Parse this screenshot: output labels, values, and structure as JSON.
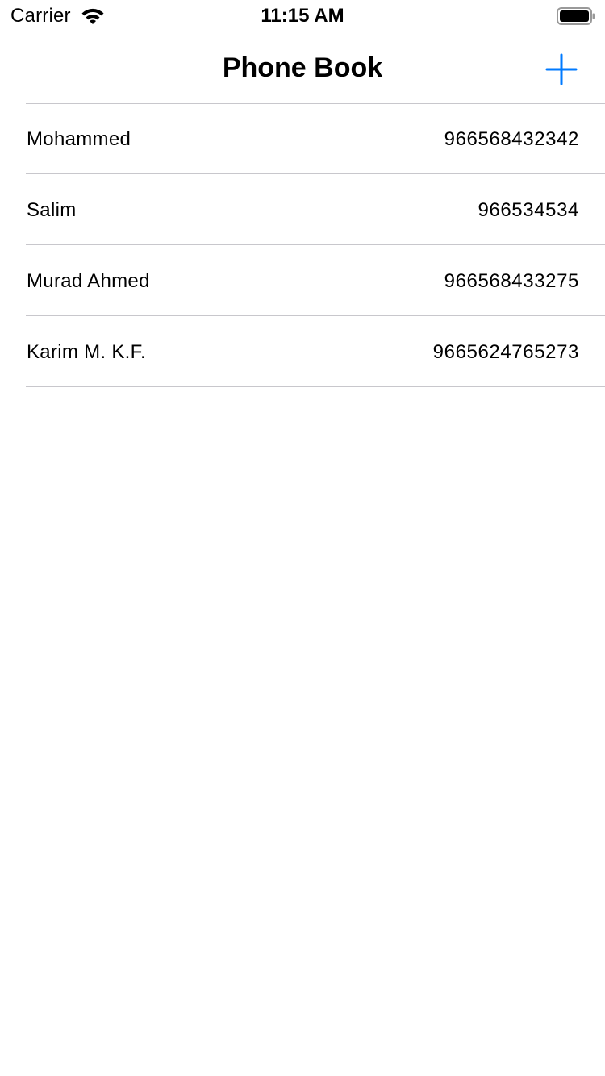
{
  "status_bar": {
    "carrier": "Carrier",
    "time": "11:15 AM",
    "wifi_icon": "wifi-icon",
    "battery_icon": "battery-icon"
  },
  "nav": {
    "title": "Phone Book",
    "add_icon": "plus-icon",
    "accent_color": "#007aff"
  },
  "contacts": [
    {
      "name": "Mohammed",
      "phone": "966568432342"
    },
    {
      "name": "Salim",
      "phone": "966534534"
    },
    {
      "name": "Murad Ahmed",
      "phone": "966568433275"
    },
    {
      "name": "Karim M. K.F.",
      "phone": "9665624765273"
    }
  ]
}
